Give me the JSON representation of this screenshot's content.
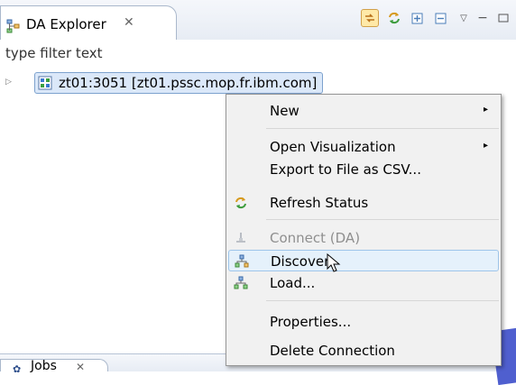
{
  "view": {
    "title": "DA Explorer",
    "close_glyph": "✕",
    "toolbar": {
      "link_icon": "link-with-editor-icon",
      "refresh_icon": "refresh-icon",
      "expand_icon": "expand-all-icon",
      "collapse_icon": "collapse-all-icon",
      "menu_glyph": "▽",
      "minimize_glyph": "−"
    }
  },
  "filter": {
    "placeholder": "type filter text"
  },
  "tree": {
    "nodes": [
      {
        "label": "zt01:3051 [zt01.pssc.mop.fr.ibm.com]",
        "icon": "server-connection-icon"
      }
    ]
  },
  "context_menu": {
    "items": [
      {
        "label": "New",
        "submenu": true
      },
      {
        "label": "Open Visualization",
        "submenu": true
      },
      {
        "label": "Export to File as CSV..."
      },
      {
        "label": "Refresh Status",
        "icon": "refresh-icon"
      },
      {
        "label": "Connect (DA)",
        "disabled": true,
        "icon": "connect-icon"
      },
      {
        "label": "Discover",
        "icon": "discover-icon",
        "hover": true
      },
      {
        "label": "Load...",
        "icon": "load-icon"
      },
      {
        "label": "Properties..."
      },
      {
        "label": "Delete Connection"
      }
    ],
    "submenu_glyph": "▸"
  },
  "bottom_view": {
    "title": "Jobs",
    "close_glyph": "✕"
  },
  "colors": {
    "selection_bg": "#dbe8f9",
    "selection_border": "#7da2ce",
    "menu_bg": "#f1f1f1",
    "hover_bg": "#e5f1fb"
  }
}
